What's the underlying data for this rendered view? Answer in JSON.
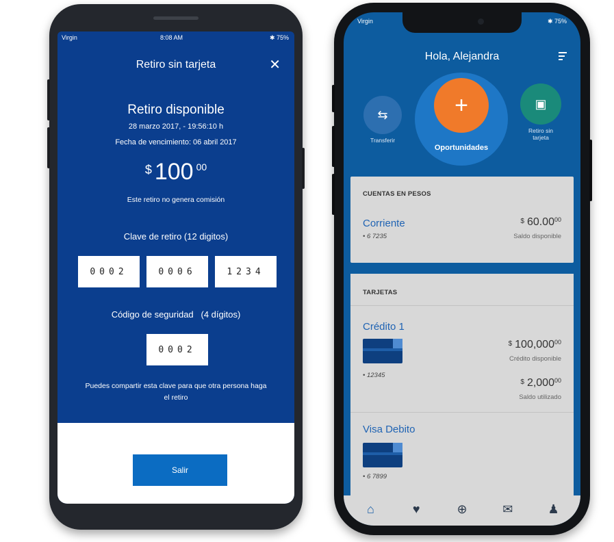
{
  "left_phone": {
    "status": {
      "carrier": "Virgin",
      "time": "8:08 AM",
      "battery": "✱ 75%"
    },
    "title": "Retiro sin tarjeta",
    "close_icon": "close-icon",
    "heading": "Retiro disponible",
    "date": "28 marzo 2017, - 19:56:10 h",
    "expiry": "Fecha de vencimiento: 06 abril 2017",
    "amount": {
      "currency": "$",
      "integer": "100",
      "decimals": "00"
    },
    "no_commission": "Este retiro no genera comisión",
    "clave_label": "Clave de retiro (12 digitos)",
    "clave_groups": [
      "0002",
      "0006",
      "1234"
    ],
    "security_label": "Código de seguridad   (4 dígitos)",
    "security_code": "0002",
    "share_text": "Puedes compartir esta clave para que otra persona haga el retiro",
    "exit_button": "Salir",
    "colors": {
      "primary": "#0b3e8e",
      "button": "#0b6cc2"
    }
  },
  "right_phone": {
    "status": {
      "carrier": "Virgin",
      "battery": "✱ 75%"
    },
    "greeting": "Hola, Alejandra",
    "actions": {
      "transfer": {
        "label": "Transferir",
        "icon": "transfer-arrows-icon"
      },
      "opportunities": {
        "label": "Oportunidades",
        "icon": "plus-icon"
      },
      "cardless": {
        "label": "Retiro sin tarjeta",
        "icon": "cash-icon"
      }
    },
    "accounts_header": "CUENTAS EN PESOS",
    "account": {
      "name": "Corriente",
      "number": "• 6 7235",
      "currency": "$",
      "integer": "60.00",
      "decimals": "00",
      "sub": "Saldo disponible"
    },
    "cards_header": "TARJETAS",
    "credit_card": {
      "name": "Crédito 1",
      "number": "• 12345",
      "available": {
        "currency": "$",
        "integer": "100,000",
        "decimals": "00",
        "sub": "Crédito disponible"
      },
      "used": {
        "currency": "$",
        "integer": "2,000",
        "decimals": "00",
        "sub": "Saldo utilizado"
      }
    },
    "debit_card": {
      "name": "Visa Debito",
      "number": "• 6 7899"
    },
    "nav": [
      "home-icon",
      "heart-pulse-icon",
      "add-circle-icon",
      "mail-icon",
      "profile-icon"
    ],
    "colors": {
      "primary": "#0d5c9f",
      "accent_orange": "#f07a2a",
      "teal": "#1a8a7a"
    }
  }
}
